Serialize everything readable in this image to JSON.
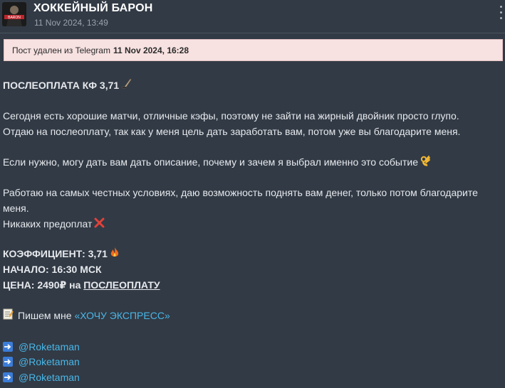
{
  "header": {
    "channel_name": "ХОККЕЙНЫЙ БАРОН",
    "post_date": "11 Nov 2024, 13:49",
    "avatar_icon": "hockey-baron-avatar",
    "menu_icon": "vertical-dots-icon"
  },
  "notice": {
    "prefix": "Пост удален из Telegram",
    "date": "11 Nov 2024, 16:28"
  },
  "post": {
    "title": "ПОСЛЕОПЛАТА КФ 3,71",
    "title_emoji": "hockey-stick-icon",
    "p1_line1": "Сегодня есть хорошие матчи, отличные кэфы, поэтому не зайти на жирный двойник просто глупо.",
    "p1_line2": "Отдаю на послеоплату, так как у меня цель дать заработать вам, потом уже вы благодарите меня.",
    "p2": "Если нужно, могу дать вам дать описание, почему и зачем я выбрал именно это событие",
    "p2_emoji": "ok-hand-icon",
    "p3_line1": "Работаю на самых честных условиях, даю возможность поднять вам денег, только потом благодарите",
    "p3_line2": "меня.",
    "p4": "Никаких предоплат",
    "p4_emoji": "cross-mark-icon",
    "coef": "КОЭФФИЦИЕНТ: 3,71",
    "coef_emoji": "fire-icon",
    "start": "НАЧАЛО: 16:30 МСК",
    "price_prefix": "ЦЕНА: 2490₽ на",
    "price_link": "ПОСЛЕОПЛАТУ",
    "write_prefix": "Пишем мне",
    "write_link": "«ХОЧУ ЭКСПРЕСС»",
    "write_emoji": "memo-icon",
    "contacts": [
      "@Roketaman",
      "@Roketaman",
      "@Roketaman"
    ],
    "contact_emoji": "right-arrow-icon"
  },
  "colors": {
    "background": "#323a45",
    "link": "#49b7e8",
    "notice_bg": "#f7e1e1"
  }
}
